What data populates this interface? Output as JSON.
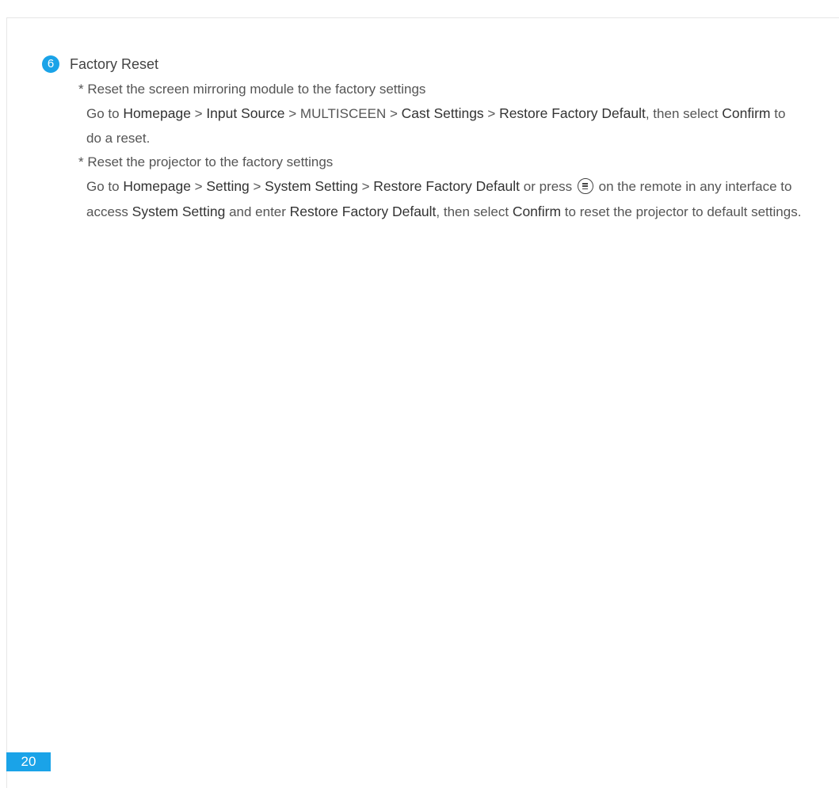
{
  "section": {
    "number": "6",
    "title": "Factory Reset"
  },
  "items": [
    {
      "title": "* Reset the screen mirroring module to the factory settings",
      "segments": [
        "Go to ",
        "Homepage",
        " > ",
        "Input Source",
        " > MULTISCEEN > ",
        "Cast Settings",
        " > ",
        "Restore Factory Default",
        ", then select ",
        "Confirm",
        " to do a reset."
      ]
    },
    {
      "title": "* Reset the projector to the factory settings",
      "segments": [
        "Go to ",
        "Homepage",
        " > ",
        "Setting",
        " > ",
        "System Setting",
        " > ",
        "Restore Factory Default",
        " or press ",
        " on the remote in any interface to access ",
        "System Setting",
        " and enter ",
        "Restore Factory Default",
        ", then select ",
        "Confirm",
        " to reset the projector to default settings."
      ],
      "icon": "menu-button-icon"
    }
  ],
  "page_number": "20",
  "colors": {
    "accent": "#1aa3e8",
    "text": "#555555",
    "bold_text": "#333333"
  }
}
